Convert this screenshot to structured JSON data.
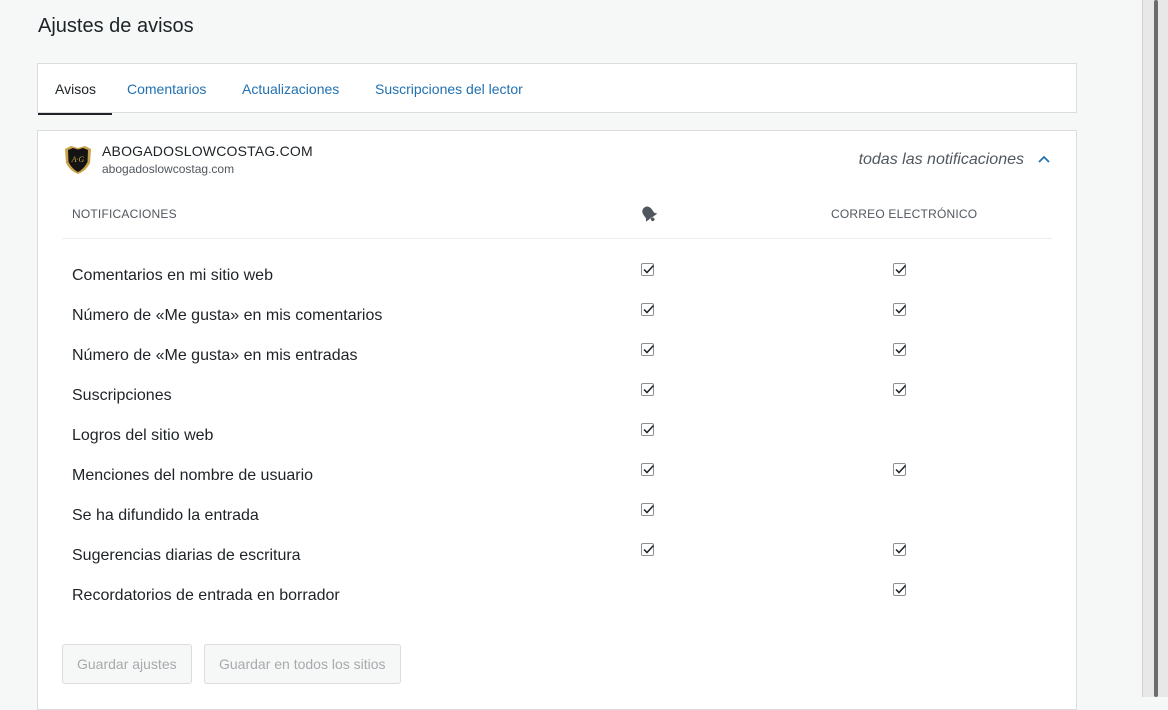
{
  "page": {
    "title": "Ajustes de avisos"
  },
  "tabs": [
    {
      "label": "Avisos",
      "active": true
    },
    {
      "label": "Comentarios",
      "active": false
    },
    {
      "label": "Actualizaciones",
      "active": false
    },
    {
      "label": "Suscripciones del lector",
      "active": false
    }
  ],
  "site": {
    "name": "ABOGADOSLOWCOSTAG.COM",
    "url": "abogadoslowcostag.com",
    "summary": "todas las notificaciones",
    "logo_icon": "shield-logo-icon"
  },
  "columns": {
    "notifications": "NOTIFICACIONES",
    "push_icon": "bell-icon",
    "email": "CORREO ELECTRÓNICO"
  },
  "settings": [
    {
      "label": "Comentarios en mi sitio web",
      "push": true,
      "email": true
    },
    {
      "label": "Número de «Me gusta» en mis comentarios",
      "push": true,
      "email": true
    },
    {
      "label": "Número de «Me gusta» en mis entradas",
      "push": true,
      "email": true
    },
    {
      "label": "Suscripciones",
      "push": true,
      "email": true
    },
    {
      "label": "Logros del sitio web",
      "push": true,
      "email": null
    },
    {
      "label": "Menciones del nombre de usuario",
      "push": true,
      "email": true
    },
    {
      "label": "Se ha difundido la entrada",
      "push": true,
      "email": null
    },
    {
      "label": "Sugerencias diarias de escritura",
      "push": true,
      "email": true
    },
    {
      "label": "Recordatorios de entrada en borrador",
      "push": null,
      "email": true
    }
  ],
  "buttons": {
    "save": "Guardar ajustes",
    "save_all": "Guardar en todos los sitios"
  },
  "colors": {
    "link": "#2271b1",
    "text": "#1d2327",
    "muted": "#50575e"
  }
}
